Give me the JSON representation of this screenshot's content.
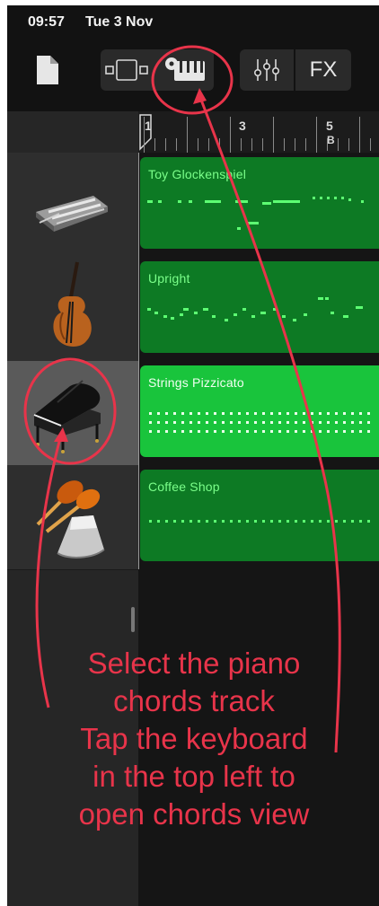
{
  "status_bar": {
    "time": "09:57",
    "date": "Tue 3 Nov"
  },
  "toolbar": {
    "buttons": [
      {
        "name": "my-songs",
        "icon": "document-icon"
      },
      {
        "name": "tracks-view",
        "icon": "tracks-view-icon"
      },
      {
        "name": "keyboard-chords",
        "icon": "keyboard-gear-icon"
      },
      {
        "name": "mixer",
        "icon": "mixer-sliders-icon"
      },
      {
        "name": "fx",
        "label": "FX"
      }
    ]
  },
  "ruler": {
    "bar_numbers": [
      "1",
      "3",
      "5"
    ],
    "section_marker": "B"
  },
  "tracks": [
    {
      "name": "Toy Glockenspiel",
      "instrument_icon": "glockenspiel-icon",
      "selected": false
    },
    {
      "name": "Upright",
      "instrument_icon": "upright-bass-icon",
      "selected": false
    },
    {
      "name": "Strings Pizzicato",
      "instrument_icon": "grand-piano-icon",
      "selected": true
    },
    {
      "name": "Coffee Shop",
      "instrument_icon": "maracas-cowbell-icon",
      "selected": false
    }
  ],
  "annotation": {
    "lines": [
      "Select the piano",
      "chords track",
      "Tap the keyboard",
      "in the top left to",
      "open chords view"
    ],
    "color": "#e8344a"
  },
  "colors": {
    "region_green": "#0d7a24",
    "region_selected_green": "#19c43c",
    "note_green": "#5dff73"
  }
}
